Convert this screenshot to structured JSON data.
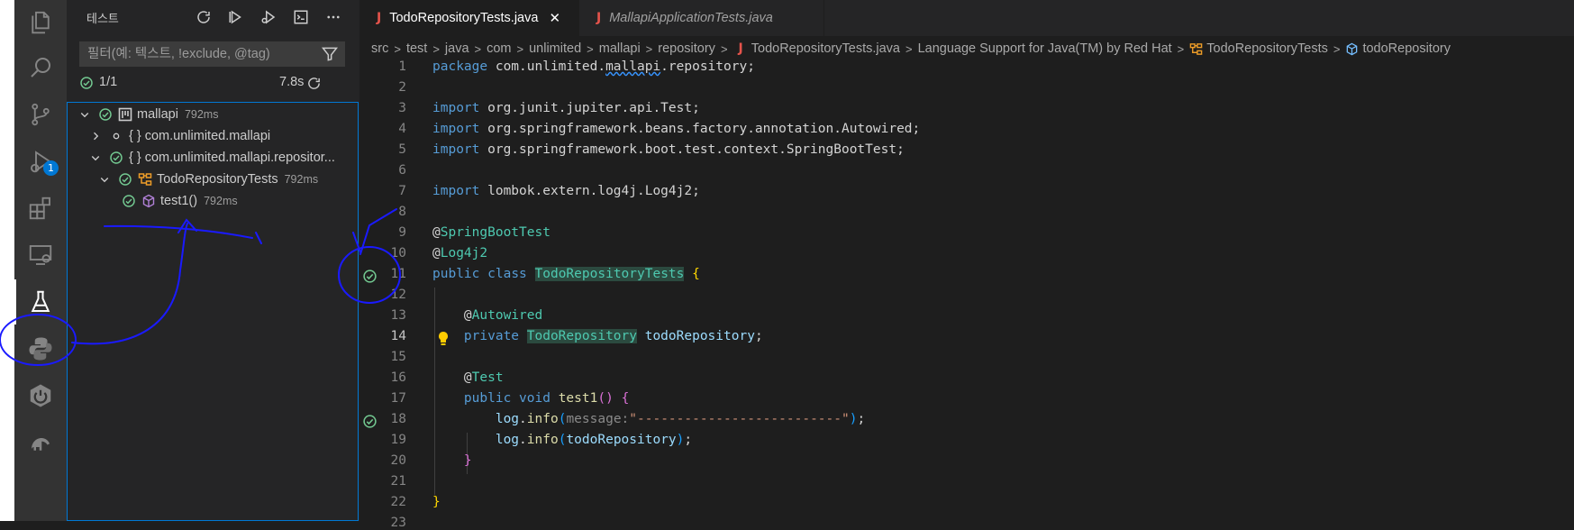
{
  "activity_bar": {
    "items": [
      {
        "icon": "explorer-icon"
      },
      {
        "icon": "search-icon"
      },
      {
        "icon": "source-control-icon"
      },
      {
        "icon": "run-debug-icon",
        "badge": "1"
      },
      {
        "icon": "extensions-icon"
      },
      {
        "icon": "remote-explorer-icon"
      },
      {
        "icon": "testing-beaker-icon",
        "active": true
      },
      {
        "icon": "python-icon"
      },
      {
        "icon": "spring-boot-icon"
      },
      {
        "icon": "gradle-elephant-icon"
      }
    ]
  },
  "sidebar": {
    "title": "테스트",
    "actions": [
      "refresh-icon",
      "run-all-icon",
      "debug-all-icon",
      "terminal-icon",
      "more-icon"
    ],
    "filter_placeholder": "필터(예: 텍스트, !exclude, @tag)",
    "summary": {
      "passed": "1/1",
      "duration": "7.8s"
    },
    "tree": [
      {
        "label": "mallapi",
        "duration": "792ms",
        "status": "passed"
      },
      {
        "label": "{ } com.unlimited.mallapi",
        "duration": "",
        "status": "unrun"
      },
      {
        "label": "{ } com.unlimited.mallapi.repositor...",
        "duration": "",
        "status": "passed"
      },
      {
        "label": "TodoRepositoryTests",
        "duration": "792ms",
        "status": "passed"
      },
      {
        "label": "test1()",
        "duration": "792ms",
        "status": "passed"
      }
    ]
  },
  "tabs": [
    {
      "label": "TodoRepositoryTests.java",
      "active": true,
      "icon": "J"
    },
    {
      "label": "MallapiApplicationTests.java",
      "active": false,
      "icon": "J"
    }
  ],
  "breadcrumb": [
    "src",
    "test",
    "java",
    "com",
    "unlimited",
    "mallapi",
    "repository",
    "TodoRepositoryTests.java",
    "Language Support for Java(TM) by Red Hat",
    "TodoRepositoryTests",
    "todoRepository"
  ],
  "editor": {
    "line_numbers": [
      "1",
      "2",
      "3",
      "4",
      "5",
      "6",
      "7",
      "8",
      "9",
      "10",
      "11",
      "12",
      "13",
      "14",
      "15",
      "16",
      "17",
      "18",
      "19",
      "20",
      "21",
      "22",
      "23"
    ],
    "current_line": "14",
    "passed_markers_on_lines": [
      "11",
      "17"
    ],
    "lightbulb_line": "14",
    "code": {
      "package_kw": "package",
      "package_name": " com.unlimited.",
      "package_mallapi": "mallapi",
      "package_rest": ".repository;",
      "import_kw": "import",
      "import1": " org.junit.jupiter.api.Test;",
      "import2": " org.springframework.beans.factory.annotation.Autowired;",
      "import3": " org.springframework.boot.test.context.SpringBootTest;",
      "import4": " lombok.extern.log4j.Log4j2;",
      "at": "@",
      "ann_springboottest": "SpringBootTest",
      "ann_log4j2": "Log4j2",
      "public_kw": "public",
      "class_kw": "class",
      "class_name": "TodoRepositoryTests",
      "brace_open": "{",
      "brace_close": "}",
      "ann_autowired": "Autowired",
      "private_kw": "private",
      "field_type": "TodoRepository",
      "field_name": "todoRepository",
      "semicolon": ";",
      "ann_test": "Test",
      "void_kw": "void",
      "method_name": "test1",
      "parens": "()",
      "log": "log",
      "dot": ".",
      "info": "info",
      "paren_open": "(",
      "paren_close": ")",
      "hint_message": "message:",
      "string_dashes": "\"--------------------------\"",
      "arg_todo": "todoRepository"
    }
  },
  "colors": {
    "accent": "#0078d4",
    "passed": "#73c991",
    "annotation_ink": "#1a1aff"
  }
}
